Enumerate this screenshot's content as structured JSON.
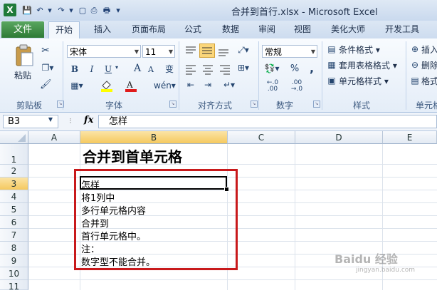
{
  "window": {
    "title": "合并到首行.xlsx - Microsoft Excel",
    "app_icon": "X"
  },
  "quick_access": [
    {
      "name": "save-icon",
      "glyph": "💾"
    },
    {
      "name": "undo-icon",
      "glyph": "↶"
    },
    {
      "name": "undo-dropdown-icon",
      "glyph": "▾"
    },
    {
      "name": "redo-icon",
      "glyph": "↷"
    },
    {
      "name": "redo-dropdown-icon",
      "glyph": "▾"
    },
    {
      "name": "new-icon",
      "glyph": "▢"
    },
    {
      "name": "print-preview-icon",
      "glyph": "⎙"
    },
    {
      "name": "print-icon",
      "glyph": "🖶"
    },
    {
      "name": "customize-qat-icon",
      "glyph": "▾"
    }
  ],
  "tabs": {
    "file": "文件",
    "home": "开始",
    "insert": "插入",
    "page_layout": "页面布局",
    "formulas": "公式",
    "data": "数据",
    "review": "审阅",
    "view": "视图",
    "meihua": "美化大师",
    "developer": "开发工具"
  },
  "ribbon": {
    "clipboard": {
      "label": "剪贴板",
      "paste": "粘贴"
    },
    "font": {
      "label": "字体",
      "name": "宋体",
      "size": "11",
      "bold": "B",
      "italic": "I",
      "underline": "U",
      "grow": "A",
      "shrink": "A",
      "wen": "变"
    },
    "alignment": {
      "label": "对齐方式"
    },
    "number": {
      "label": "数字",
      "format": "常规",
      "percent": "%",
      "comma": ","
    },
    "styles": {
      "label": "样式",
      "conditional": "条件格式",
      "table": "套用表格格式",
      "cell_styles": "单元格样式"
    },
    "cells": {
      "label": "单元格",
      "insert": "插入",
      "delete": "删除",
      "format": "格式"
    }
  },
  "formula_bar": {
    "name_box": "B3",
    "fx": "fx",
    "content": "怎样"
  },
  "columns": [
    "A",
    "B",
    "C",
    "D",
    "E"
  ],
  "rows": [
    "1",
    "2",
    "3",
    "4",
    "5",
    "6",
    "7",
    "8",
    "9",
    "10",
    "11"
  ],
  "cells": {
    "b1": "合并到首单元格",
    "b3": "怎样",
    "b4": "将1列中",
    "b5": "多行单元格内容",
    "b6": "合并到",
    "b7": "首行单元格中。",
    "b8": "注：",
    "b9": "数字型不能合并。"
  },
  "watermark": {
    "main": "Baidu 经验",
    "sub": "jingyan.baidu.com"
  },
  "colors": {
    "file_tab": "#2d7a36",
    "red_box": "#c8191b",
    "selected_header": "#f5c95f"
  }
}
